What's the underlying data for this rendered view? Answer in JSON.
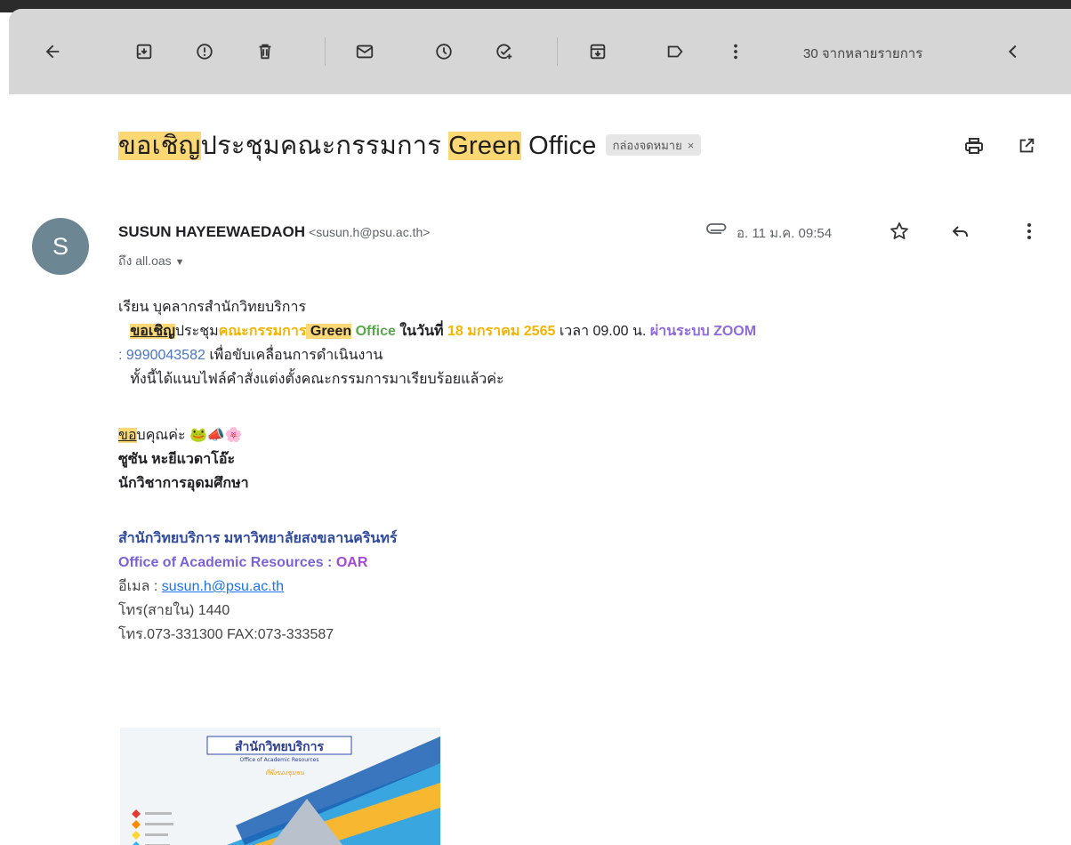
{
  "toolbar": {
    "buttons": [
      {
        "name": "back-button",
        "icon": "arrow-left-icon"
      },
      {
        "name": "archive-button",
        "icon": "archive-icon"
      },
      {
        "name": "report-spam-button",
        "icon": "report-icon"
      },
      {
        "name": "delete-button",
        "icon": "trash-icon"
      },
      {
        "name": "mark-unread-button",
        "icon": "mail-icon"
      },
      {
        "name": "snooze-button",
        "icon": "clock-icon"
      },
      {
        "name": "add-task-button",
        "icon": "task-add-icon"
      },
      {
        "name": "move-to-button",
        "icon": "move-icon"
      },
      {
        "name": "labels-button",
        "icon": "label-icon"
      },
      {
        "name": "more-button",
        "icon": "more-vert-icon"
      },
      {
        "name": "prev-button",
        "icon": "chevron-left-icon"
      }
    ],
    "count_text": "30 จากหลายรายการ"
  },
  "subject": {
    "part1": "ขอเชิญ",
    "part2": "ประชุมคณะกรรมการ ",
    "part3": "Green",
    "part4": " Office",
    "label": "กล่องจดหมาย",
    "label_close": "×"
  },
  "message": {
    "avatar_letter": "S",
    "sender_name": "SUSUN HAYEEWAEDAOH",
    "sender_email": "<susun.h@psu.ac.th>",
    "to": "ถึง all.oas",
    "date": "อ. 11 ม.ค. 09:54"
  },
  "body": {
    "greeting": "เรียน บุคลากรสำนักวิทยบริการ",
    "l2_a": "ขอเชิญ",
    "l2_b": "ประชุม",
    "l2_c": "คณะกรรมการ",
    "l2_d": " Green",
    "l2_e": " Office",
    "l2_f": "  ในวันที่ ",
    "l2_g": "18 มกราคม 2565",
    "l2_h": " เวลา 09.00 น. ",
    "l2_i": "ผ่านระบบ ZOOM",
    "l3_a": ": 9990043582",
    "l3_b": " เพื่อขับเคลื่อนการดำเนินงาน",
    "l4": "ทั้งนี้ได้แนบไฟล์คำสั่งแต่งตั้งคณะกรรมการมาเรียบร้อยแล้วค่ะ",
    "thanks_a": "ขอ",
    "thanks_b": "บคุณค่ะ ",
    "thanks_emoji": "🐸📣🌸",
    "sig_name": "ซูซัน  หะยีแวดาโอ๊ะ",
    "sig_title": "นักวิชาการอุดมศึกษา",
    "org_th": "สำนักวิทยบริการ มหาวิทยาลัยสงขลานครินทร์",
    "org_en_a": "Office of Academic Resources : ",
    "org_en_b": "OAR",
    "email_label": "อีเมล : ",
    "email_link": "susun.h@psu.ac.th",
    "phone_internal": "โทร(สายใน) 1440",
    "phone_fax": "โทร.073-331300 FAX:073-333587"
  },
  "poster": {
    "title": "สำนักวิทยบริการ",
    "subtitle": "Office of Academic Resources",
    "tagline": "ที่พึ่งของชุมชน"
  },
  "colors": {
    "toolbar_bg": "#d6d6d6",
    "highlight": "#fcd874",
    "avatar": "#6c8693",
    "orange": "#f4b400",
    "purple": "#8e6bd9",
    "green": "#5aa84d",
    "link": "#1a73e8"
  }
}
